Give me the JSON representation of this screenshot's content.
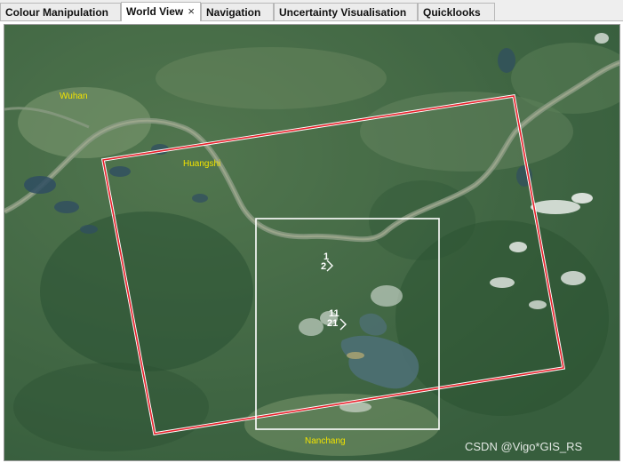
{
  "tabs": [
    {
      "label": "Colour Manipulation",
      "active": false
    },
    {
      "label": "World View",
      "active": true,
      "close_icon": "×"
    },
    {
      "label": "Navigation",
      "active": false
    },
    {
      "label": "Uncertainty Visualisation",
      "active": false
    },
    {
      "label": "Quicklooks",
      "active": false
    }
  ],
  "map": {
    "places": {
      "wuhan": "Wuhan",
      "huangshi": "Huangshi",
      "nanchang": "Nanchang"
    },
    "scene_markers": {
      "upper": {
        "line1": "1",
        "line2": "2"
      },
      "lower": {
        "line1": "11",
        "line2": "21"
      }
    },
    "footprints": {
      "outer_color": "#e8202a",
      "inner_color": "#ffffff"
    },
    "watermark": "CSDN @Vigo*GIS_RS"
  }
}
